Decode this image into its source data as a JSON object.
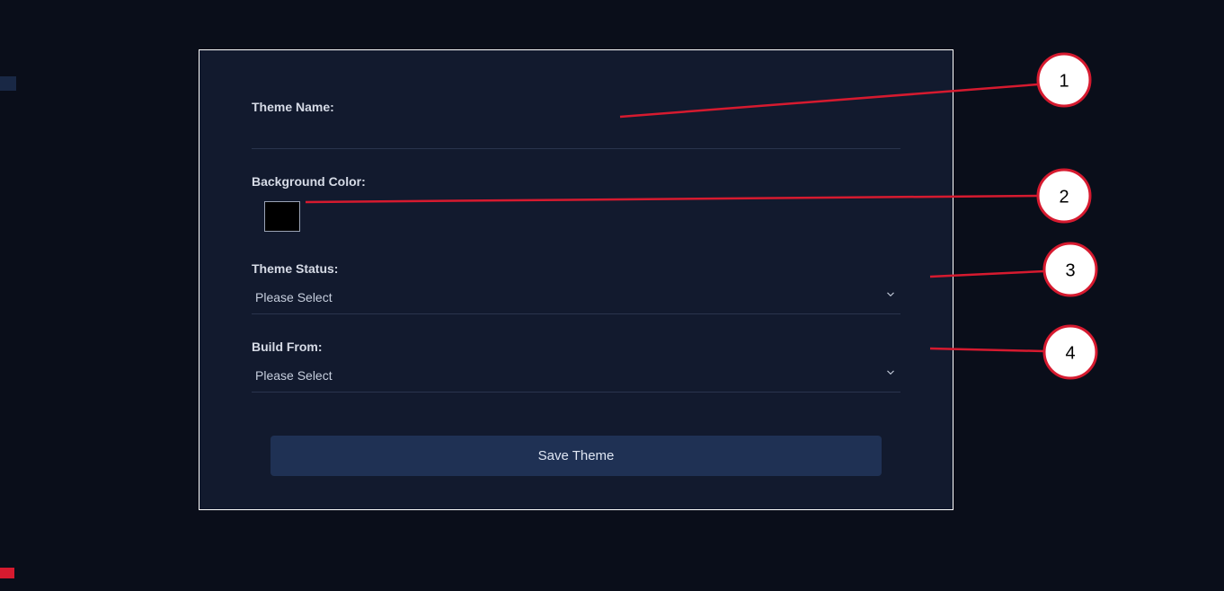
{
  "form": {
    "theme_name": {
      "label": "Theme Name:",
      "value": ""
    },
    "background_color": {
      "label": "Background Color:",
      "value": "#000000"
    },
    "theme_status": {
      "label": "Theme Status:",
      "placeholder": "Please Select",
      "value": "Please Select"
    },
    "build_from": {
      "label": "Build From:",
      "placeholder": "Please Select",
      "value": "Please Select"
    },
    "save_label": "Save Theme"
  },
  "annotations": {
    "markers": [
      "1",
      "2",
      "3",
      "4"
    ]
  },
  "colors": {
    "page_bg": "#0a0e1a",
    "panel_bg": "#121a2e",
    "accent": "#1f3154",
    "annotation": "#d61a2f"
  }
}
